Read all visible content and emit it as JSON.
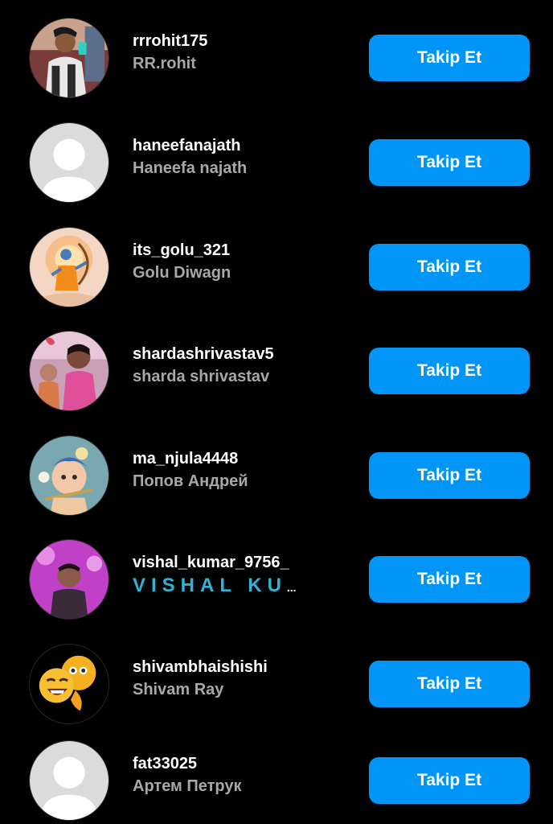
{
  "accent_color": "#0095f6",
  "follow_label": "Takip Et",
  "suggestions": [
    {
      "username": "rrrohit175",
      "full_name": "RR.rohit",
      "avatar": "photo-man-mirror-selfie"
    },
    {
      "username": "haneefanajath",
      "full_name": "Haneefa najath",
      "avatar": "default-avatar-icon"
    },
    {
      "username": "its_golu_321",
      "full_name": "Golu Diwagn",
      "avatar": "illustration-archer"
    },
    {
      "username": "shardashrivastav5",
      "full_name": "sharda shrivastav",
      "avatar": "photo-woman-child"
    },
    {
      "username": "ma_njula4448",
      "full_name": "Попов Андрей",
      "avatar": "illustration-krishna-child"
    },
    {
      "username": "vishal_kumar_9756_",
      "full_name": "VISHAL KU",
      "full_name_suffix": "...",
      "avatar": "photo-man-pink-light"
    },
    {
      "username": "shivambhaishishi",
      "full_name": "Shivam Ray",
      "avatar": "emoji-faces"
    },
    {
      "username": "fat33025",
      "full_name": "Артем Петрук",
      "avatar": "default-avatar-icon"
    }
  ]
}
